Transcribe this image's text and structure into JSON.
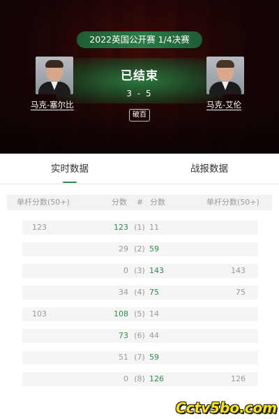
{
  "header": {
    "event": "2022英国公开赛 1/4决赛",
    "status": "已结束",
    "score": "3 - 5",
    "badge": "破百",
    "player_left": {
      "name": "马克-塞尔比"
    },
    "player_right": {
      "name": "马克-艾伦"
    }
  },
  "tabs": [
    {
      "label": "实时数据",
      "active": true
    },
    {
      "label": "战报数据",
      "active": false
    }
  ],
  "table": {
    "columns": [
      "单杆分数(50+)",
      "分数",
      "#",
      "分数",
      "单杆分数(50+)"
    ],
    "rows": [
      {
        "break_left": "123",
        "score_left": "123",
        "frame": "(1)",
        "score_right": "11",
        "break_right": "",
        "winner": "left"
      },
      {
        "break_left": "",
        "score_left": "29",
        "frame": "(2)",
        "score_right": "59",
        "break_right": "",
        "winner": "right"
      },
      {
        "break_left": "",
        "score_left": "0",
        "frame": "(3)",
        "score_right": "143",
        "break_right": "143",
        "winner": "right"
      },
      {
        "break_left": "",
        "score_left": "34",
        "frame": "(4)",
        "score_right": "75",
        "break_right": "75",
        "winner": "right"
      },
      {
        "break_left": "103",
        "score_left": "108",
        "frame": "(5)",
        "score_right": "14",
        "break_right": "",
        "winner": "left"
      },
      {
        "break_left": "",
        "score_left": "73",
        "frame": "(6)",
        "score_right": "44",
        "break_right": "",
        "winner": "left"
      },
      {
        "break_left": "",
        "score_left": "51",
        "frame": "(7)",
        "score_right": "59",
        "break_right": "",
        "winner": "right"
      },
      {
        "break_left": "",
        "score_left": "0",
        "frame": "(8)",
        "score_right": "126",
        "break_right": "126",
        "winner": "right"
      }
    ]
  },
  "watermark": "Cctv5bo.com",
  "colors": {
    "accent": "#2f8a4f",
    "hero_bg": "#1a0606",
    "pill": "#2d7a47"
  }
}
